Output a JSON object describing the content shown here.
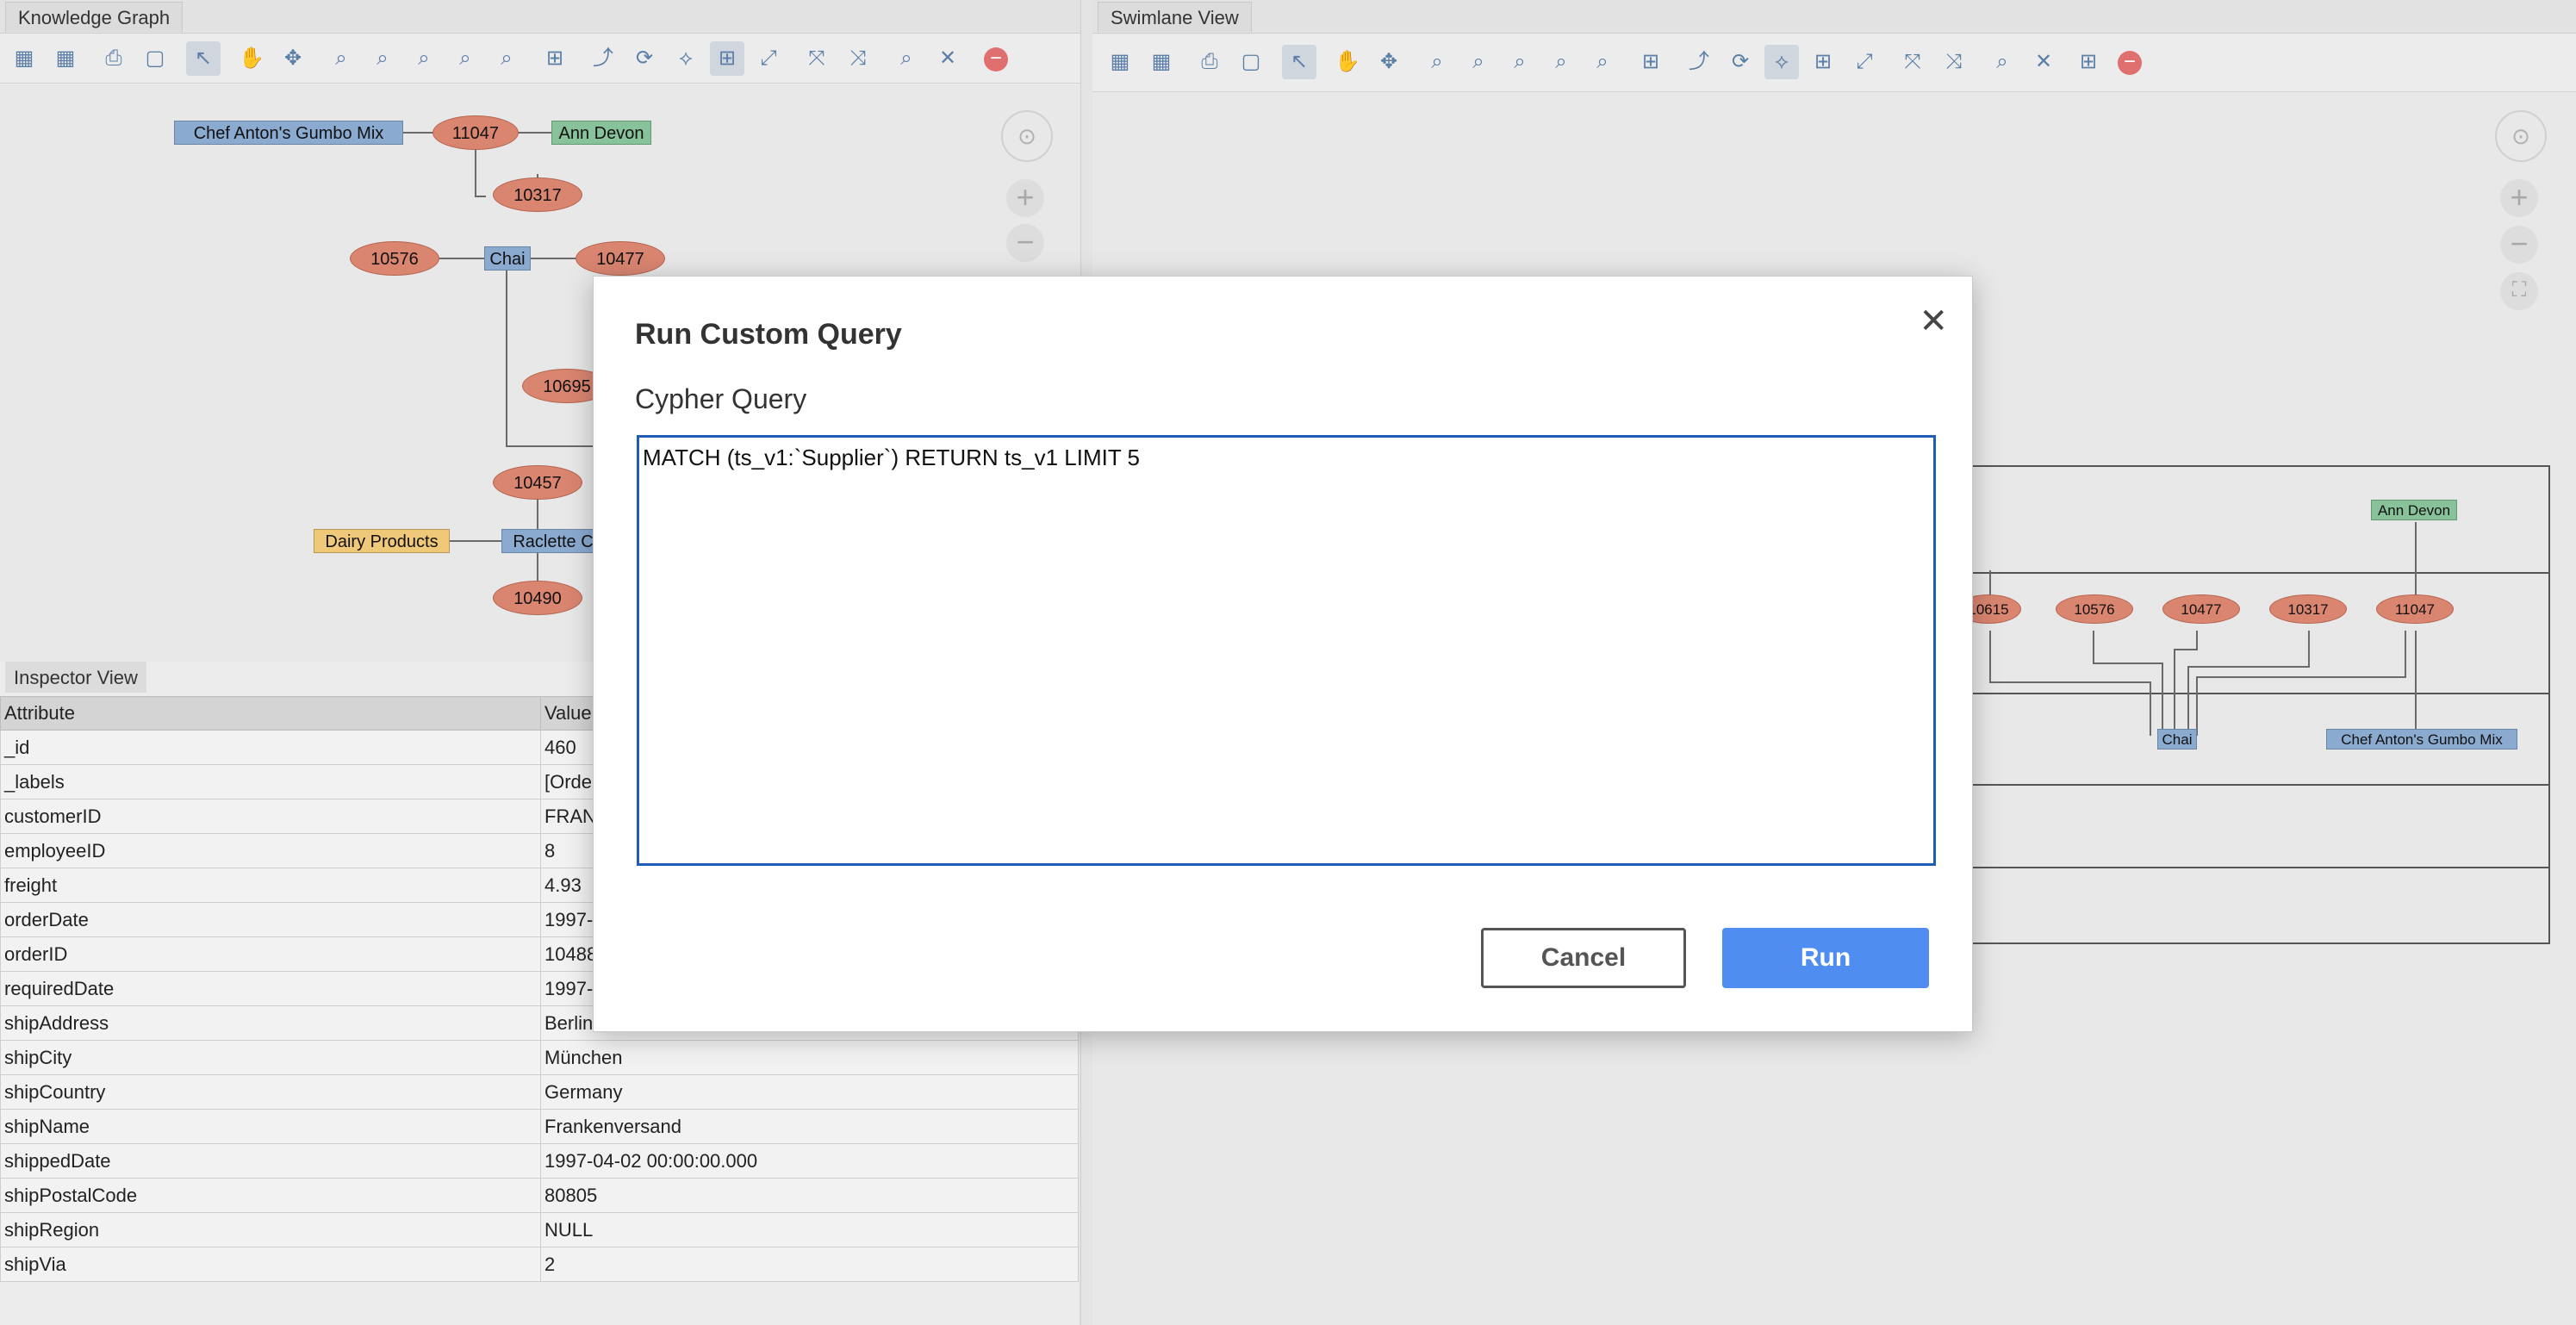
{
  "knowledge_graph": {
    "tab_label": "Knowledge Graph",
    "nodes": {
      "gumbo": "Chef Anton's Gumbo Mix",
      "o11047": "11047",
      "ann": "Ann Devon",
      "o10317": "10317",
      "o10576": "10576",
      "chai": "Chai",
      "o10477": "10477",
      "o10695": "10695",
      "o10457": "10457",
      "dairy": "Dairy Products",
      "raclette": "Raclette C",
      "o10490": "10490"
    }
  },
  "swimlane": {
    "tab_label": "Swimlane View",
    "nodes": {
      "ann": "Ann Devon",
      "o10615": "10615",
      "o10576": "10576",
      "o10477": "10477",
      "o10317": "10317",
      "o11047": "11047",
      "chai": "Chai",
      "gumbo": "Chef Anton's Gumbo Mix"
    }
  },
  "inspector": {
    "tab_label": "Inspector View",
    "headers": [
      "Attribute",
      "Value"
    ],
    "rows": [
      [
        "_id",
        "460"
      ],
      [
        "_labels",
        "[Orde"
      ],
      [
        "customerID",
        "FRAN"
      ],
      [
        "employeeID",
        "8"
      ],
      [
        "freight",
        "4.93"
      ],
      [
        "orderDate",
        "1997-"
      ],
      [
        "orderID",
        "10488"
      ],
      [
        "requiredDate",
        "1997-"
      ],
      [
        "shipAddress",
        "Berlin"
      ],
      [
        "shipCity",
        "München"
      ],
      [
        "shipCountry",
        "Germany"
      ],
      [
        "shipName",
        "Frankenversand"
      ],
      [
        "shippedDate",
        "1997-04-02 00:00:00.000"
      ],
      [
        "shipPostalCode",
        "80805"
      ],
      [
        "shipRegion",
        "NULL"
      ],
      [
        "shipVia",
        "2"
      ]
    ]
  },
  "modal": {
    "title": "Run Custom Query",
    "field_label": "Cypher Query",
    "query_value": "MATCH (ts_v1:`Supplier`) RETURN ts_v1 LIMIT 5",
    "close_glyph": "✕",
    "cancel_label": "Cancel",
    "run_label": "Run"
  },
  "icons": {
    "nav": "⊙",
    "zoom_in": "+",
    "zoom_out": "−",
    "fit": "⛶",
    "toolbar": [
      "▦",
      "▦",
      "⎙",
      "▢",
      "↖",
      "✋",
      "✥",
      "⌕",
      "⌕",
      "⌕",
      "⌕",
      "⌕",
      "⊞",
      "⤴",
      "⟳",
      "⟡",
      "⊞",
      "⤢",
      "⤧",
      "⤨",
      "⌕",
      "✕"
    ],
    "remove": "−"
  },
  "colors": {
    "product_node": "#8aaad0",
    "order_node": "#d98570",
    "employee_node": "#88c29a",
    "category_node": "#f0c87a",
    "run_button": "#4f8ef0"
  }
}
